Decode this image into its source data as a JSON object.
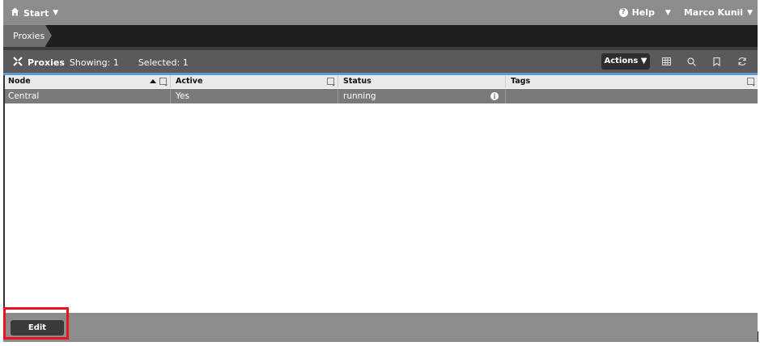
{
  "topbar": {
    "start_label": "Start",
    "help_label": "Help",
    "user_label": "Marco Kunii"
  },
  "breadcrumb": {
    "current": "Proxies"
  },
  "toolbar": {
    "title": "Proxies",
    "showing": "Showing: 1",
    "selected": "Selected: 1",
    "actions_label": "Actions"
  },
  "table": {
    "columns": [
      "Node",
      "Active",
      "Status",
      "Tags"
    ],
    "rows": [
      {
        "node": "Central",
        "active": "Yes",
        "status": "running",
        "tags": ""
      }
    ]
  },
  "footer": {
    "edit_label": "Edit"
  },
  "colors": {
    "topbar": "#8c8c8c",
    "crumbbar": "#1f1f1f",
    "toolbar": "#5a5a5a",
    "accent": "#5b9bd5",
    "selected_row": "#7a7a7a",
    "highlight": "#e8131f"
  }
}
